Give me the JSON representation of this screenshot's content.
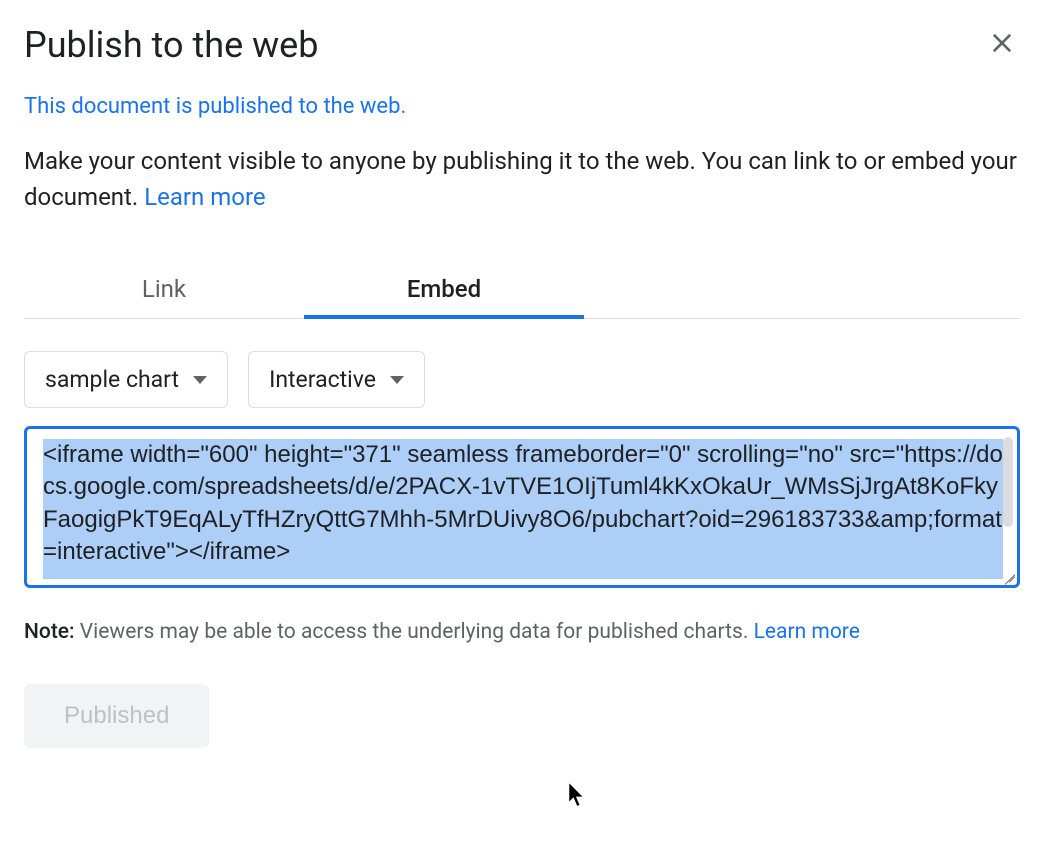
{
  "dialog": {
    "title": "Publish to the web",
    "published_notice": "This document is published to the web.",
    "description_text": "Make your content visible to anyone by publishing it to the web. You can link to or embed your document. ",
    "learn_more_label": "Learn more"
  },
  "tabs": {
    "link": "Link",
    "embed": "Embed"
  },
  "dropdowns": {
    "chart_selected": "sample chart",
    "mode_selected": "Interactive"
  },
  "embed": {
    "code": "<iframe width=\"600\" height=\"371\" seamless frameborder=\"0\" scrolling=\"no\" src=\"https://docs.google.com/spreadsheets/d/e/2PACX-1vTVE1OIjTuml4kKxOkaUr_WMsSjJrgAt8KoFkyFaogigPkT9EqALyTfHZryQttG7Mhh-5MrDUivy8O6/pubchart?oid=296183733&amp;format=interactive\"></iframe>"
  },
  "note": {
    "label": "Note:",
    "text": " Viewers may be able to access the underlying data for published charts. ",
    "learn_more": "Learn more"
  },
  "buttons": {
    "published": "Published"
  }
}
